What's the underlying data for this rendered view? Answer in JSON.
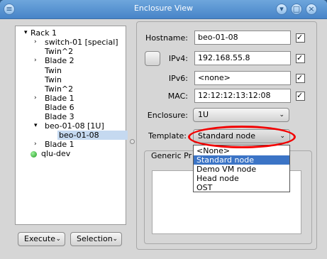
{
  "window": {
    "title": "Enclosure View",
    "close_glyph": "×",
    "min_glyph": "▾",
    "max_glyph": "□"
  },
  "tree": {
    "rows": [
      {
        "label": "Rack 1",
        "expander": "▾"
      },
      {
        "label": "switch-01 [special]",
        "expander": "›"
      },
      {
        "label": "Twin^2",
        "expander": ""
      },
      {
        "label": "Blade 2",
        "expander": "›"
      },
      {
        "label": "Twin",
        "expander": ""
      },
      {
        "label": "Twin",
        "expander": ""
      },
      {
        "label": "Twin^2",
        "expander": ""
      },
      {
        "label": "Blade 1",
        "expander": "›"
      },
      {
        "label": "Blade 6",
        "expander": ""
      },
      {
        "label": "Blade 3",
        "expander": ""
      },
      {
        "label": "beo-01-08 [1U]",
        "expander": "▾"
      },
      {
        "label": "beo-01-08",
        "expander": ""
      },
      {
        "label": "Blade 1",
        "expander": "›"
      },
      {
        "label": "qlu-dev",
        "expander": ""
      }
    ]
  },
  "buttons": {
    "execute": "Execute",
    "selection": "Selection"
  },
  "form": {
    "hostname_label": "Hostname:",
    "hostname_value": "beo-01-08",
    "ipv4_label": "IPv4:",
    "ipv4_value": "192.168.55.8",
    "ipv6_label": "IPv6:",
    "ipv6_value": "<none>",
    "mac_label": "MAC:",
    "mac_value": "12:12:12:13:12:08",
    "enclosure_label": "Enclosure:",
    "enclosure_value": "1U",
    "template_label": "Template:",
    "template_value": "Standard node",
    "group_title": "Generic Pr",
    "check_glyph": "✓"
  },
  "dropdown": {
    "options": [
      "<None>",
      "Standard node",
      "Demo VM node",
      "Head node",
      "OST"
    ],
    "highlighted": "Standard node"
  },
  "annotation": {
    "color": "#f20000"
  }
}
